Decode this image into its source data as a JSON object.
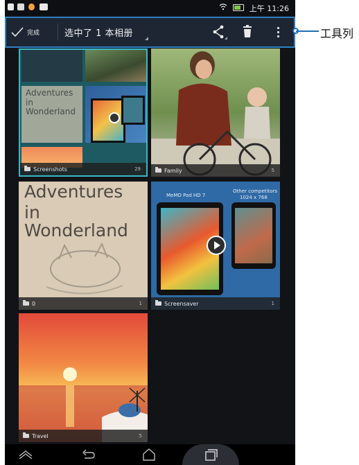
{
  "status_bar": {
    "time": "上午 11:26"
  },
  "toolbar": {
    "done_label": "完成",
    "selection_label": "选中了 1 本相册"
  },
  "annotation": {
    "label": "工具列"
  },
  "albums": [
    {
      "name": "Screenshots",
      "count": "29"
    },
    {
      "name": "Family",
      "count": "5"
    },
    {
      "name": "0",
      "count": "1"
    },
    {
      "name": "Screensaver",
      "count": "1"
    },
    {
      "name": "Travel",
      "count": "5"
    }
  ],
  "thumb_text": {
    "wonderland_line1": "Adventures",
    "wonderland_line2": "in Wonderland",
    "memo_model": "MeMO Pad HD 7",
    "competitors_line1": "Other competitors",
    "competitors_line2": "1024 x 768"
  },
  "colors": {
    "accent": "#2f7fc3",
    "toolbar_bg": "#1d2632",
    "selection_border": "#3bb7c6"
  },
  "icons": [
    "checkmark-icon",
    "share-icon",
    "trash-icon",
    "overflow-menu-icon",
    "folder-icon",
    "back-icon",
    "home-icon",
    "recents-icon",
    "collapse-icon"
  ]
}
